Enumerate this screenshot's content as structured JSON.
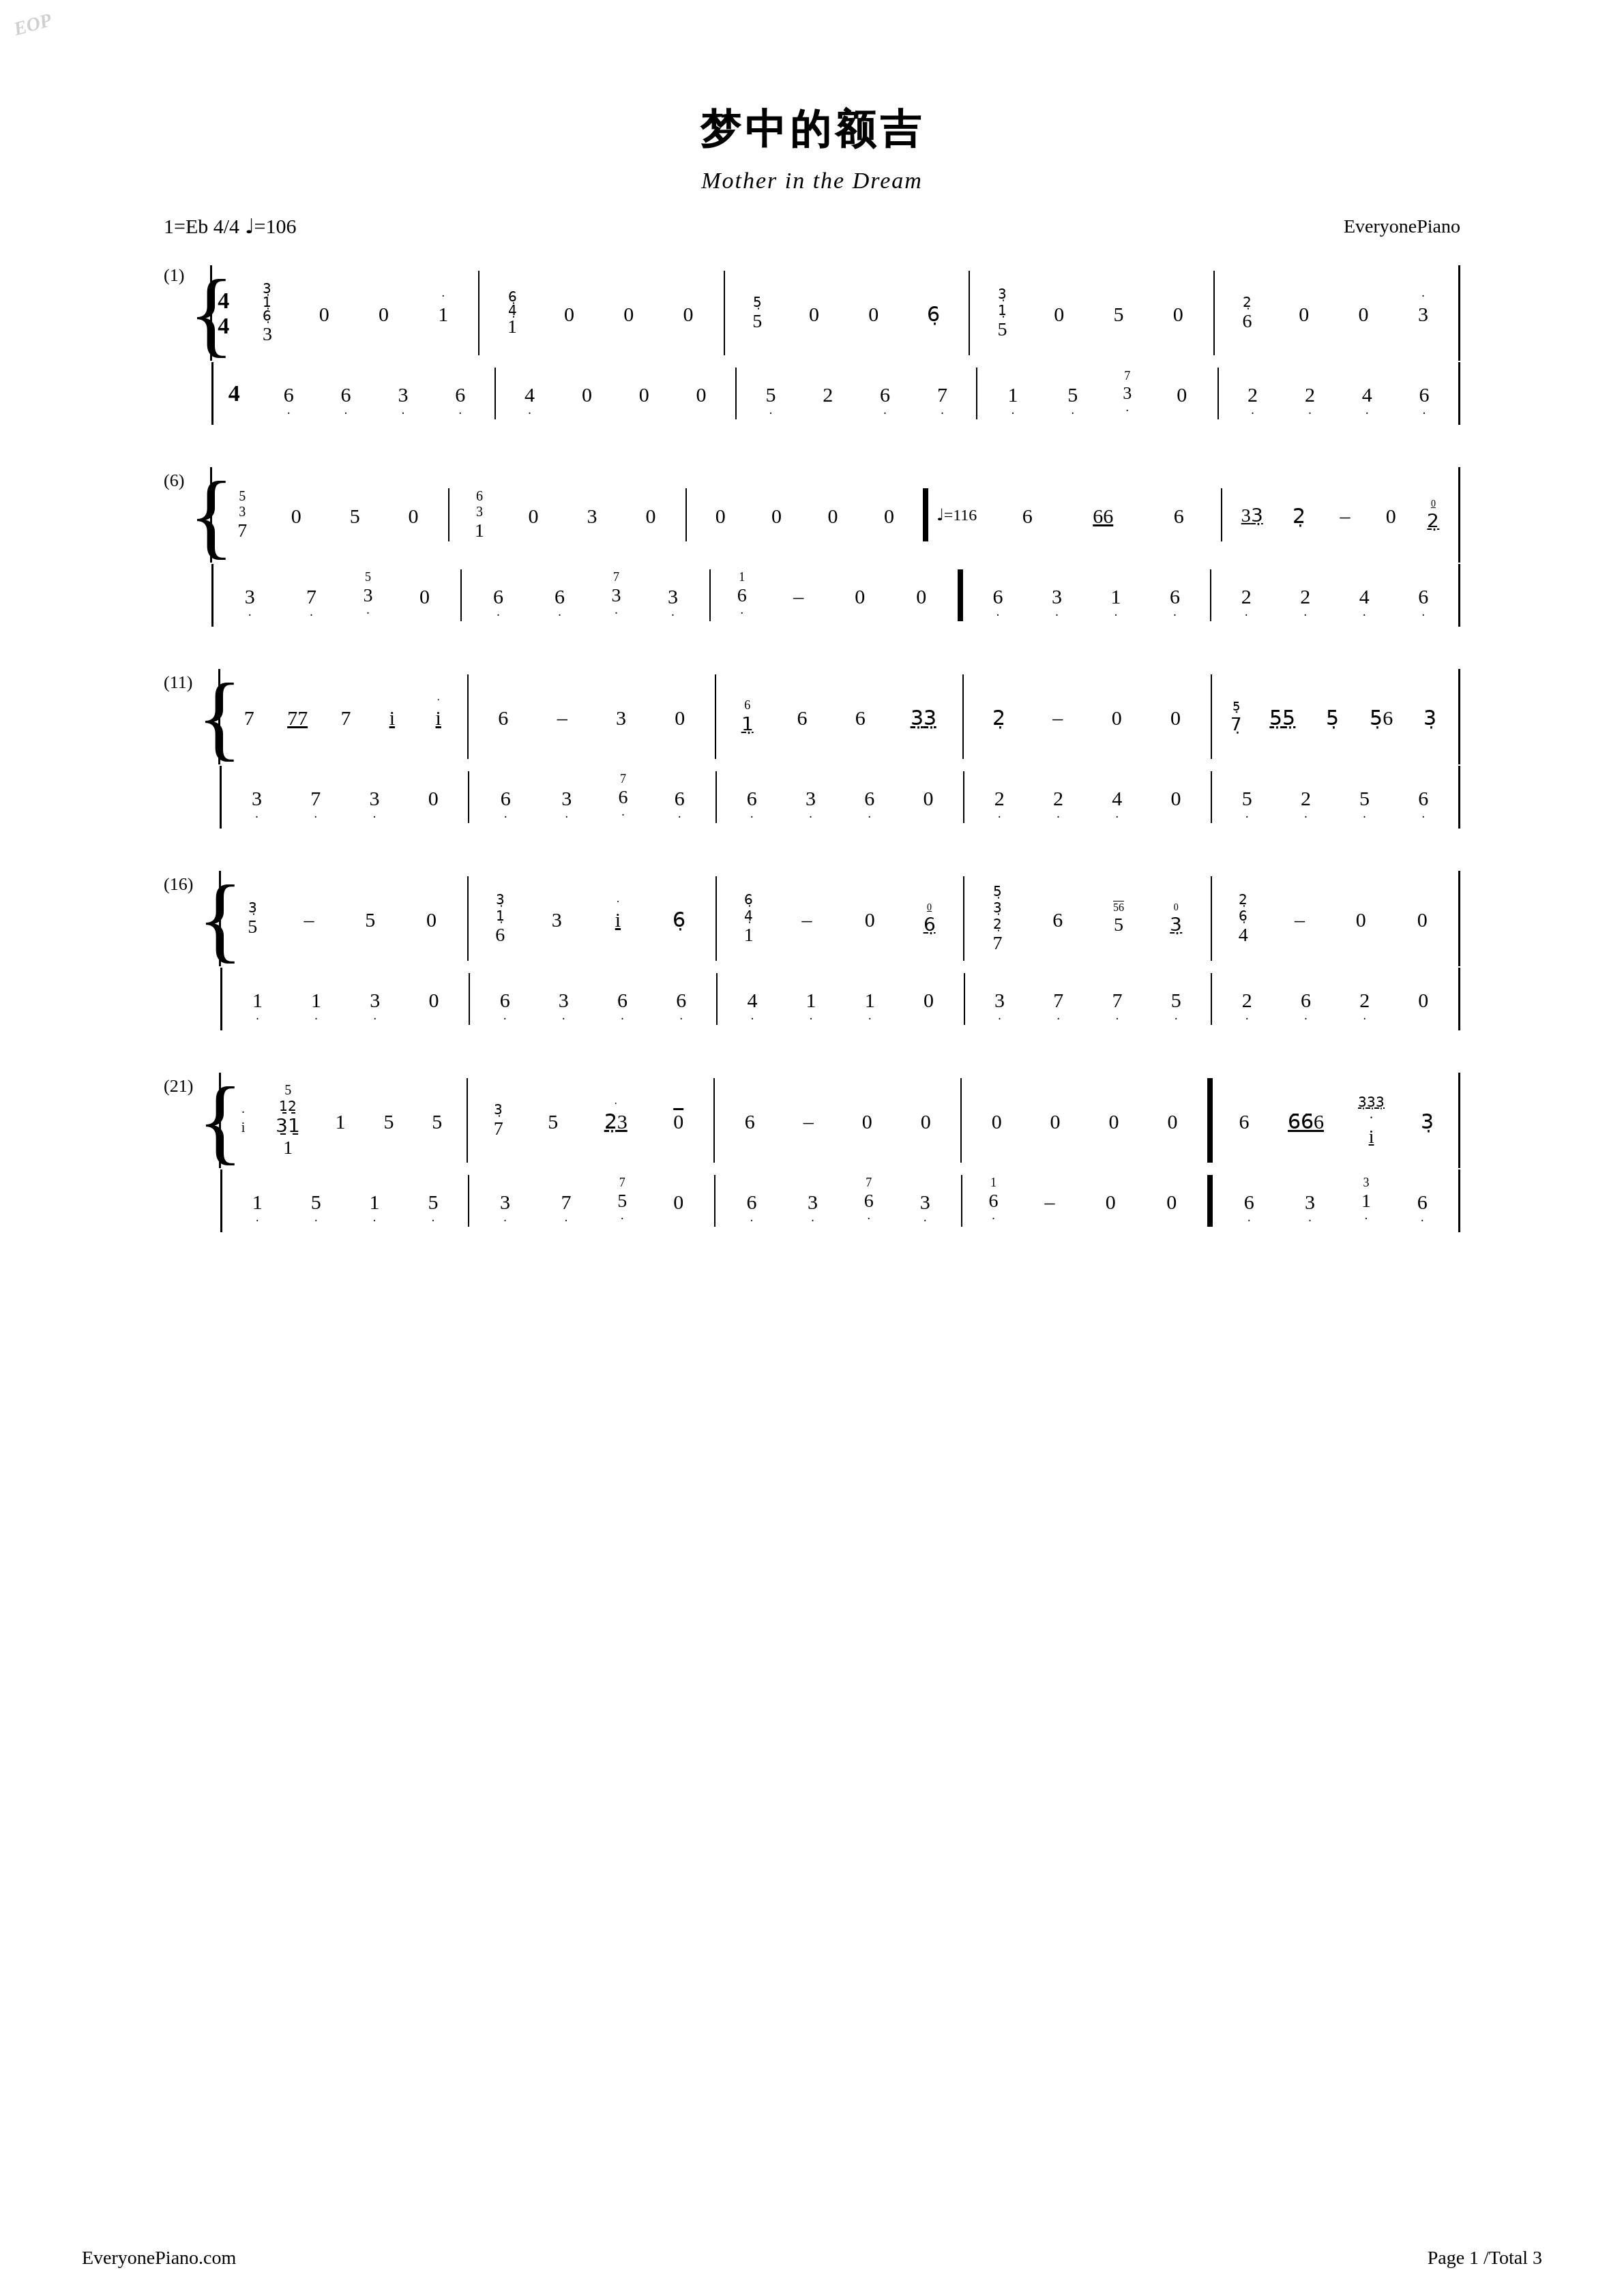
{
  "page": {
    "watermark": "EOP",
    "title_chinese": "梦中的额吉",
    "title_english": "Mother in the Dream",
    "key_tempo": "1=Eb 4/4 ♩=106",
    "publisher": "EveryonePiano",
    "footer_left": "EveryonePiano.com",
    "footer_right": "Page 1 /Total 3"
  }
}
